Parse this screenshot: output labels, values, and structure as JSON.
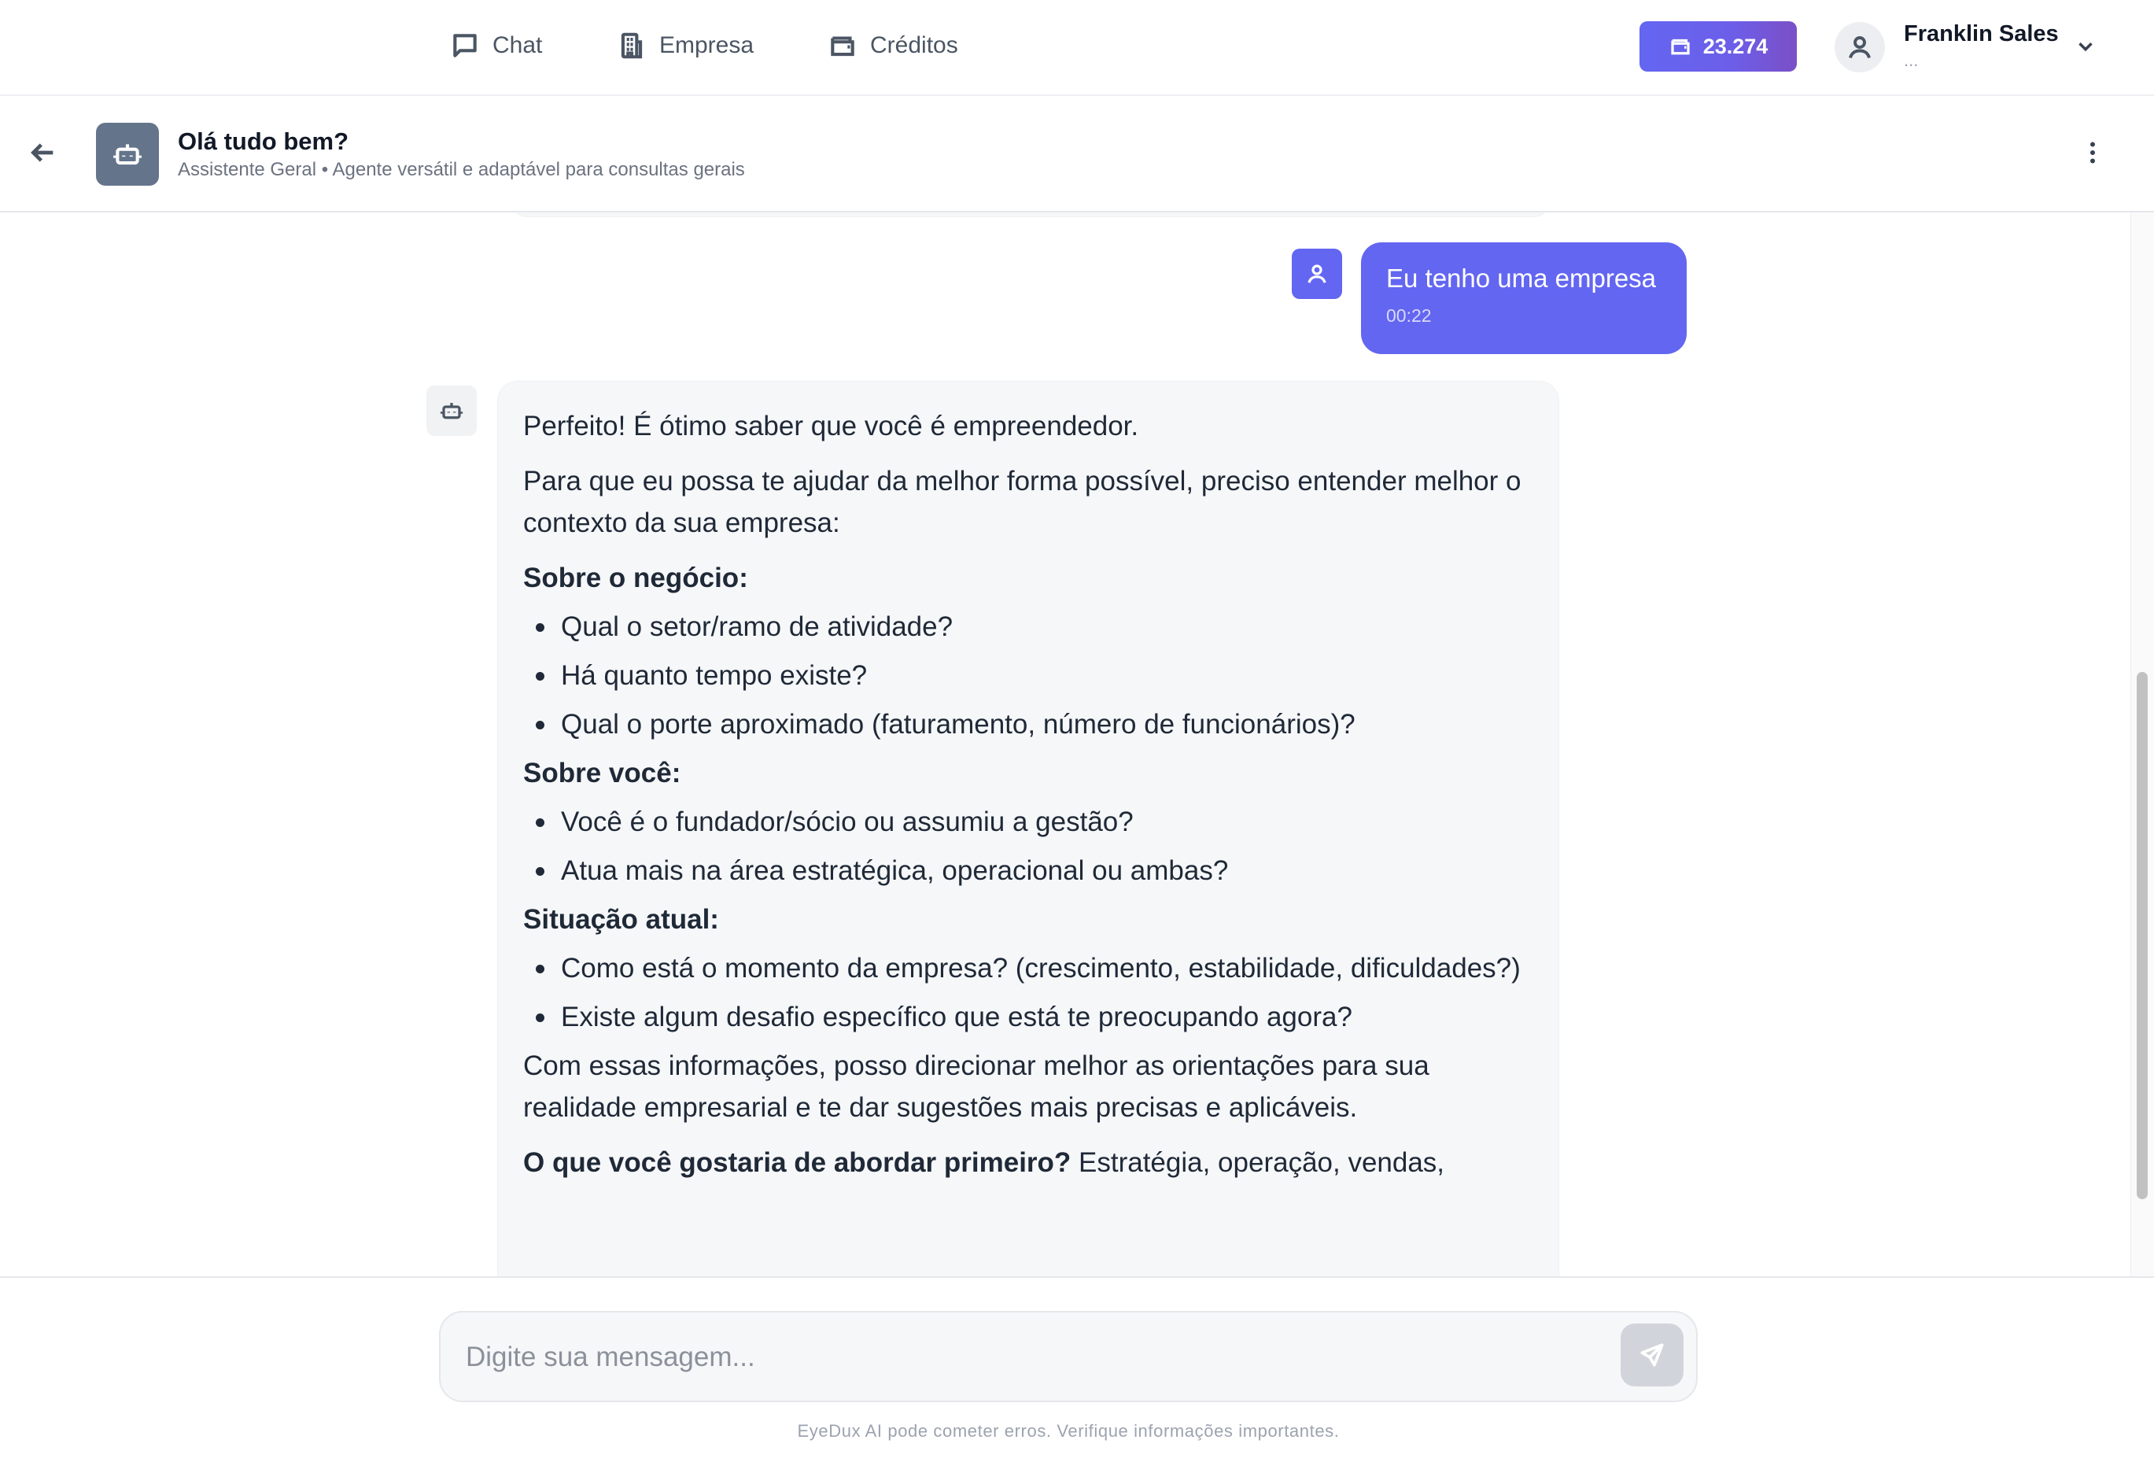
{
  "nav": {
    "items": [
      {
        "label": "Chat",
        "icon": "chat-bubble-icon"
      },
      {
        "label": "Empresa",
        "icon": "building-icon"
      },
      {
        "label": "Créditos",
        "icon": "wallet-icon"
      }
    ],
    "credits": {
      "value": "23.274",
      "icon": "wallet-icon"
    },
    "user": {
      "name": "Franklin Sales",
      "subtitle": "...",
      "icon": "user-icon"
    }
  },
  "chat_header": {
    "title": "Olá tudo bem?",
    "subtitle": "Assistente Geral • Agente versátil e adaptável para consultas gerais",
    "agent_icon": "robot-icon"
  },
  "messages": {
    "user": {
      "text": "Eu tenho uma empresa",
      "time": "00:22"
    },
    "bot": {
      "intro": "Perfeito! É ótimo saber que você é empreendedor.",
      "para1": "Para que eu possa te ajudar da melhor forma possível, preciso entender melhor o contexto da sua empresa:",
      "sections": [
        {
          "heading": "Sobre o negócio:",
          "items": [
            "Qual o setor/ramo de atividade?",
            "Há quanto tempo existe?",
            "Qual o porte aproximado (faturamento, número de funcionários)?"
          ]
        },
        {
          "heading": "Sobre você:",
          "items": [
            "Você é o fundador/sócio ou assumiu a gestão?",
            "Atua mais na área estratégica, operacional ou ambas?"
          ]
        },
        {
          "heading": "Situação atual:",
          "items": [
            "Como está o momento da empresa? (crescimento, estabilidade, dificuldades?)",
            "Existe algum desafio específico que está te preocupando agora?"
          ]
        }
      ],
      "para2": "Com essas informações, posso direcionar melhor as orientações para sua realidade empresarial e te dar sugestões mais precisas e aplicáveis.",
      "closing_bold": "O que você gostaria de abordar primeiro?",
      "closing_rest": " Estratégia, operação, vendas,"
    }
  },
  "composer": {
    "placeholder": "Digite sua mensagem...",
    "disclaimer": "EyeDux AI pode cometer erros. Verifique informações importantes."
  }
}
